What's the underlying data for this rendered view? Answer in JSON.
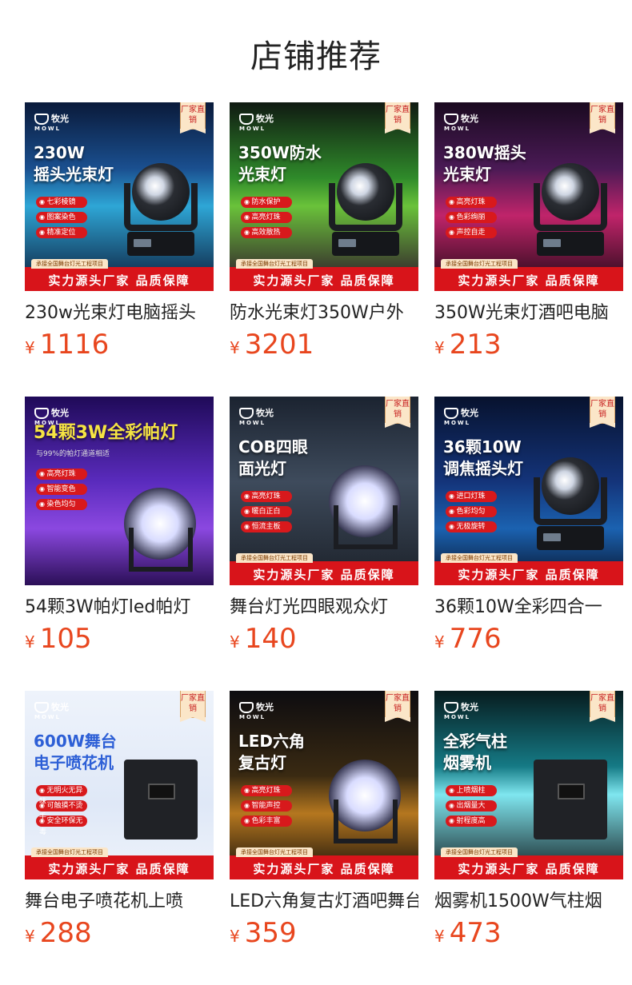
{
  "page": {
    "title": "店铺推荐"
  },
  "products": [
    {
      "title": "230w光束灯电脑摇头",
      "currency": "¥",
      "price": "1116",
      "badge": "厂家直销",
      "brand": "牧光",
      "brand_sub": "MOWL",
      "headline": "230W\n摇头光束灯",
      "sub_caption": "",
      "features": [
        "七彩棱镜",
        "图案染色",
        "精准定位"
      ],
      "footer_tag": "承接全国舞台灯光工程项目",
      "footer_text": "实力源头厂家 品质保障",
      "bg": "linear-gradient(180deg,#0a1a3a 0%,#1a4f8f 35%,#2ea6d6 55%,#0b1633 100%)",
      "device": "beam"
    },
    {
      "title": "防水光束灯350W户外",
      "currency": "¥",
      "price": "3201",
      "badge": "厂家直销",
      "brand": "牧光",
      "brand_sub": "MOWL",
      "headline": "350W防水\n光束灯",
      "sub_caption": "",
      "features": [
        "防水保护",
        "高亮灯珠",
        "高效散热"
      ],
      "footer_tag": "承接全国舞台灯光工程项目",
      "footer_text": "实力源头厂家 品质保障",
      "bg": "linear-gradient(180deg,#101a12 0%,#2f8a2a 40%,#6ac23a 55%,#2b0c2a 100%)",
      "device": "beam"
    },
    {
      "title": "350W光束灯酒吧电脑",
      "currency": "¥",
      "price": "213",
      "badge": "厂家直销",
      "brand": "牧光",
      "brand_sub": "MOWL",
      "headline": "380W摇头\n光束灯",
      "sub_caption": "",
      "features": [
        "高亮灯珠",
        "色彩绚丽",
        "声控自走"
      ],
      "footer_tag": "承接全国舞台灯光工程项目",
      "footer_text": "实力源头厂家 品质保障",
      "bg": "linear-gradient(180deg,#1a0a20 0%,#4a1a55 35%,#c0246a 60%,#1a0812 100%)",
      "device": "beam"
    },
    {
      "title": "54颗3W帕灯led帕灯",
      "currency": "¥",
      "price": "105",
      "badge": "",
      "brand": "牧光",
      "brand_sub": "MOWL",
      "headline": "54颗3W全彩帕灯",
      "sub_caption": "与99%的帕灯通道相适",
      "features": [
        "高亮灯珠",
        "智能变色",
        "染色均匀"
      ],
      "footer_tag": "",
      "footer_text": "",
      "bg": "linear-gradient(180deg,#1f0a58 0%,#5a2bbd 45%,#8b48e0 70%,#2b0f57 100%)",
      "device": "par"
    },
    {
      "title": "舞台灯光四眼观众灯",
      "currency": "¥",
      "price": "140",
      "badge": "厂家直销",
      "brand": "牧光",
      "brand_sub": "MOWL",
      "headline": "COB四眼\n面光灯",
      "sub_caption": "",
      "features": [
        "高亮灯珠",
        "暖白正白",
        "恒流主板"
      ],
      "footer_tag": "承接全国舞台灯光工程项目",
      "footer_text": "实力源头厂家 品质保障",
      "bg": "linear-gradient(180deg,#1b2330 0%,#3e4b5c 45%,#1b2028 100%)",
      "device": "par"
    },
    {
      "title": "36颗10W全彩四合一",
      "currency": "¥",
      "price": "776",
      "badge": "厂家直销",
      "brand": "牧光",
      "brand_sub": "MOWL",
      "headline": "36颗10W\n调焦摇头灯",
      "sub_caption": "",
      "features": [
        "进口灯珠",
        "色彩均匀",
        "无极旋转"
      ],
      "footer_tag": "承接全国舞台灯光工程项目",
      "footer_text": "实力源头厂家 品质保障",
      "bg": "linear-gradient(180deg,#07122e 0%,#14347a 45%,#1b62b0 70%,#071026 100%)",
      "device": "beam"
    },
    {
      "title": "舞台电子喷花机上喷",
      "currency": "¥",
      "price": "288",
      "badge": "厂家直销",
      "brand": "牧光",
      "brand_sub": "MOWL",
      "headline": "600W舞台\n电子喷花机",
      "sub_caption": "",
      "features": [
        "无明火无异味",
        "可触摸不烫手",
        "安全环保无毒"
      ],
      "footer_tag": "承接全国舞台灯光工程项目",
      "footer_text": "实力源头厂家 品质保障",
      "bg": "linear-gradient(180deg,#eef3fb 0%,#dfe8f7 60%,#eef3fb 100%)",
      "device": "box"
    },
    {
      "title": "LED六角复古灯酒吧舞台",
      "currency": "¥",
      "price": "359",
      "badge": "厂家直销",
      "brand": "牧光",
      "brand_sub": "MOWL",
      "headline": "LED六角\n复古灯",
      "sub_caption": "",
      "features": [
        "高亮灯珠",
        "智能声控",
        "色彩丰富"
      ],
      "footer_tag": "承接全国舞台灯光工程项目",
      "footer_text": "实力源头厂家 品质保障",
      "bg": "linear-gradient(180deg,#0d0c10 0%,#3a2a12 45%,#b5771f 65%,#0d0b0a 100%)",
      "device": "par"
    },
    {
      "title": "烟雾机1500W气柱烟",
      "currency": "¥",
      "price": "473",
      "badge": "厂家直销",
      "brand": "牧光",
      "brand_sub": "MOWL",
      "headline": "全彩气柱\n烟雾机",
      "sub_caption": "",
      "features": [
        "上喷烟柱",
        "出烟量大",
        "射程度高"
      ],
      "footer_tag": "承接全国舞台灯光工程项目",
      "footer_text": "实力源头厂家 品质保障",
      "bg": "linear-gradient(180deg,#071b1e 0%,#157a85 40%,#7fe6ef 55%,#101518 100%)",
      "device": "box"
    }
  ]
}
